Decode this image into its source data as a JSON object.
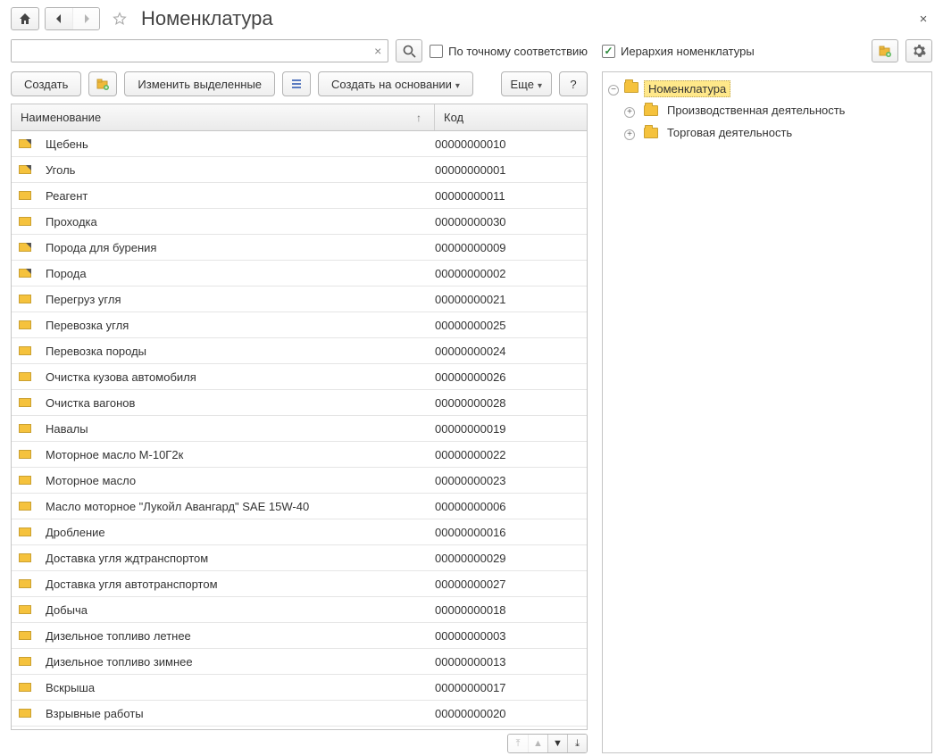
{
  "header": {
    "title": "Номенклатура"
  },
  "search": {
    "value": "",
    "placeholder": "",
    "exact_label": "По точному соответствию",
    "exact_checked": false
  },
  "right": {
    "hierarchy_label": "Иерархия номенклатуры",
    "hierarchy_checked": true
  },
  "toolbar": {
    "create": "Создать",
    "edit_selected": "Изменить выделенные",
    "create_from": "Создать на основании",
    "more": "Еще",
    "help": "?"
  },
  "table": {
    "col_name": "Наименование",
    "col_code": "Код",
    "rows": [
      {
        "name": "Щебень",
        "code": "00000000010",
        "corner": true
      },
      {
        "name": "Уголь",
        "code": "00000000001",
        "corner": true
      },
      {
        "name": "Реагент",
        "code": "00000000011",
        "corner": false
      },
      {
        "name": "Проходка",
        "code": "00000000030",
        "corner": false
      },
      {
        "name": "Порода для бурения",
        "code": "00000000009",
        "corner": true
      },
      {
        "name": "Порода",
        "code": "00000000002",
        "corner": true
      },
      {
        "name": "Перегруз угля",
        "code": "00000000021",
        "corner": false
      },
      {
        "name": "Перевозка угля",
        "code": "00000000025",
        "corner": false
      },
      {
        "name": "Перевозка породы",
        "code": "00000000024",
        "corner": false
      },
      {
        "name": "Очистка кузова автомобиля",
        "code": "00000000026",
        "corner": false
      },
      {
        "name": "Очистка вагонов",
        "code": "00000000028",
        "corner": false
      },
      {
        "name": "Навалы",
        "code": "00000000019",
        "corner": false
      },
      {
        "name": "Моторное масло М-10Г2к",
        "code": "00000000022",
        "corner": false
      },
      {
        "name": "Моторное масло",
        "code": "00000000023",
        "corner": false
      },
      {
        "name": "Масло моторное \"Лукойл Авангард\" SAE 15W-40",
        "code": "00000000006",
        "corner": false
      },
      {
        "name": "Дробление",
        "code": "00000000016",
        "corner": false
      },
      {
        "name": "Доставка угля ждтранспортом",
        "code": "00000000029",
        "corner": false
      },
      {
        "name": "Доставка угля автотранспортом",
        "code": "00000000027",
        "corner": false
      },
      {
        "name": "Добыча",
        "code": "00000000018",
        "corner": false
      },
      {
        "name": "Дизельное топливо летнее",
        "code": "00000000003",
        "corner": false
      },
      {
        "name": "Дизельное топливо зимнее",
        "code": "00000000013",
        "corner": false
      },
      {
        "name": "Вскрыша",
        "code": "00000000017",
        "corner": false
      },
      {
        "name": "Взрывные работы",
        "code": "00000000020",
        "corner": false
      }
    ]
  },
  "tree": {
    "root": "Номенклатура",
    "children": [
      "Производственная деятельность",
      "Торговая деятельность"
    ]
  }
}
